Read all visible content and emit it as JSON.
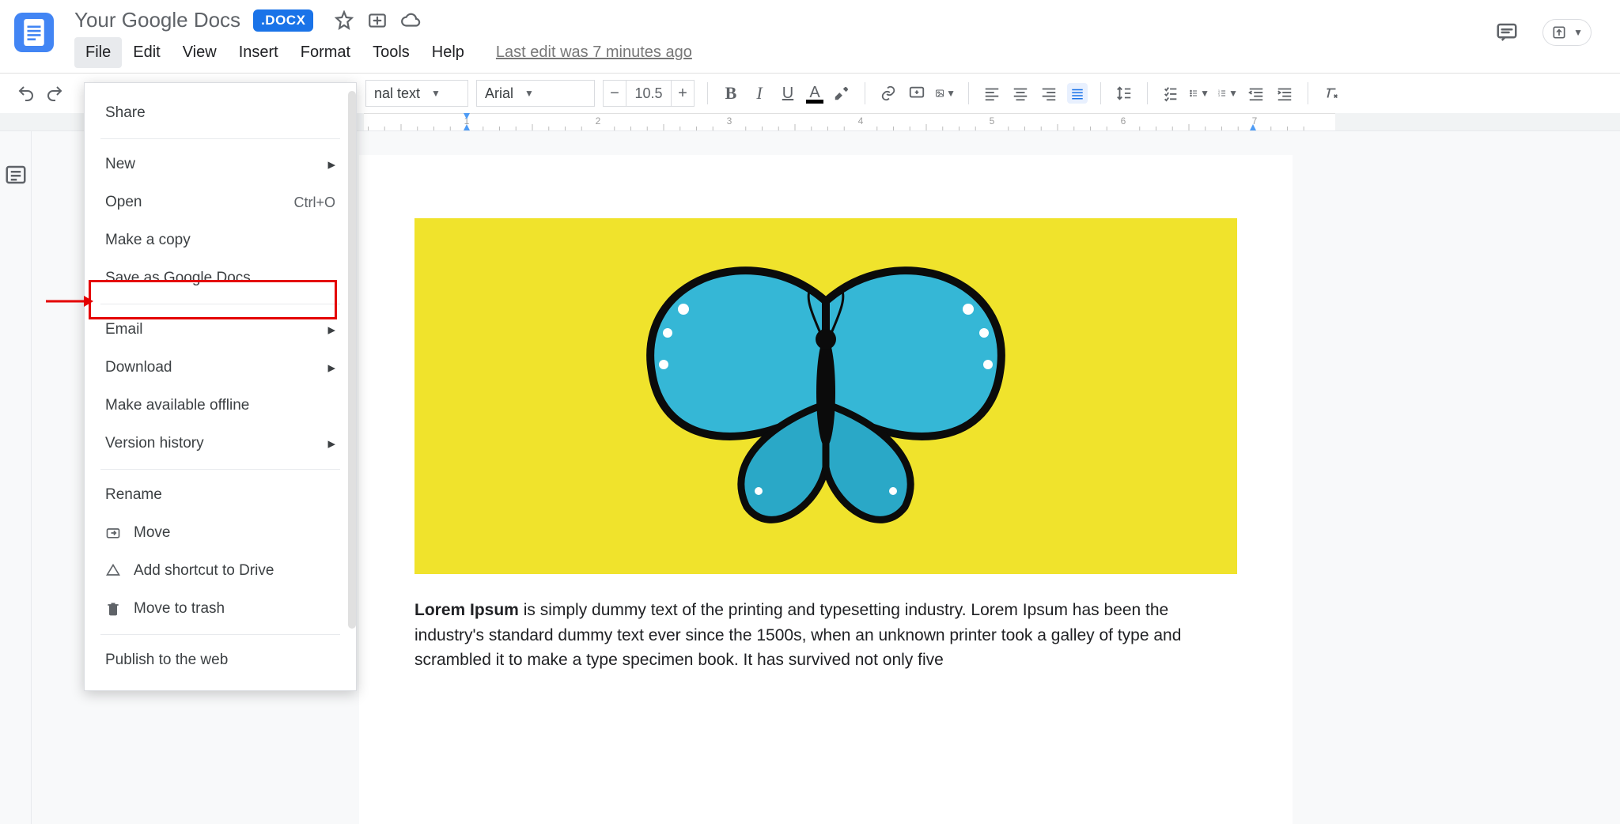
{
  "header": {
    "doc_title": "Your Google Docs",
    "badge": ".DOCX",
    "last_edit": "Last edit was 7 minutes ago"
  },
  "menubar": [
    "File",
    "Edit",
    "View",
    "Insert",
    "Format",
    "Tools",
    "Help"
  ],
  "toolbar": {
    "style_name": "nal text",
    "font_name": "Arial",
    "font_size": "10.5"
  },
  "file_menu": {
    "share": "Share",
    "new": "New",
    "open": "Open",
    "open_shortcut": "Ctrl+O",
    "make_copy": "Make a copy",
    "save_as": "Save as Google Docs",
    "email": "Email",
    "download": "Download",
    "offline": "Make available offline",
    "version": "Version history",
    "rename": "Rename",
    "move": "Move",
    "shortcut": "Add shortcut to Drive",
    "trash": "Move to trash",
    "publish": "Publish to the web"
  },
  "document": {
    "heading": "Lorem Ipsum",
    "body_1": " is simply dummy text of the printing and typesetting industry. Lorem Ipsum has been the industry's standard dummy text ever since the 1500s, when an unknown printer took a galley of type and scrambled it to make a type specimen book. It has survived not only five"
  }
}
